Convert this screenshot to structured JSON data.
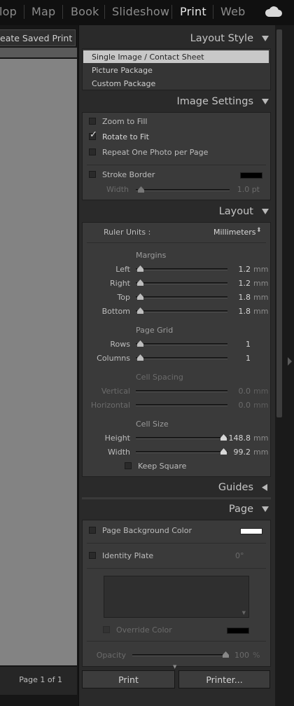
{
  "modules": {
    "items": [
      "lop",
      "Map",
      "Book",
      "Slideshow",
      "Print",
      "Web"
    ],
    "active": "Print"
  },
  "icons": {
    "cloud": "cloud-icon"
  },
  "left": {
    "saved_print_button": "eate Saved Print",
    "page_indicator": "Page 1 of 1"
  },
  "layout_style": {
    "title": "Layout Style",
    "options": [
      "Single Image / Contact Sheet",
      "Picture Package",
      "Custom Package"
    ],
    "selected": "Single Image / Contact Sheet"
  },
  "image_settings": {
    "title": "Image Settings",
    "zoom_to_fill": "Zoom to Fill",
    "rotate_to_fit": "Rotate to Fit",
    "repeat_one": "Repeat One Photo per Page",
    "stroke_border": "Stroke Border",
    "width_label": "Width",
    "width_value": "1.0 pt",
    "zoom_checked": false,
    "rotate_checked": true,
    "repeat_checked": false,
    "stroke_checked": false,
    "stroke_color": "#000000"
  },
  "layout": {
    "title": "Layout",
    "ruler_units_label": "Ruler Units :",
    "ruler_units_value": "Millimeters",
    "margins_title": "Margins",
    "left_label": "Left",
    "left_value": "1.2",
    "right_label": "Right",
    "right_value": "1.2",
    "top_label": "Top",
    "top_value": "1.8",
    "bottom_label": "Bottom",
    "bottom_value": "1.8",
    "unit": "mm",
    "page_grid_title": "Page Grid",
    "rows_label": "Rows",
    "rows_value": "1",
    "columns_label": "Columns",
    "columns_value": "1",
    "cell_spacing_title": "Cell Spacing",
    "vertical_label": "Vertical",
    "vertical_value": "0.0",
    "horizontal_label": "Horizontal",
    "horizontal_value": "0.0",
    "cell_size_title": "Cell Size",
    "height_label": "Height",
    "height_value": "148.8",
    "width_label": "Width",
    "width_value": "99.2",
    "keep_square": "Keep Square",
    "keep_square_checked": false
  },
  "guides": {
    "title": "Guides"
  },
  "page": {
    "title": "Page",
    "bg_color_label": "Page Background Color",
    "bg_color": "#ffffff",
    "identity_plate_label": "Identity Plate",
    "identity_angle": "0°",
    "override_color_label": "Override Color",
    "override_color": "#000000",
    "opacity_label": "Opacity",
    "opacity_value": "100",
    "opacity_unit": "%"
  },
  "footer": {
    "print_button": "Print",
    "printer_button": "Printer..."
  }
}
